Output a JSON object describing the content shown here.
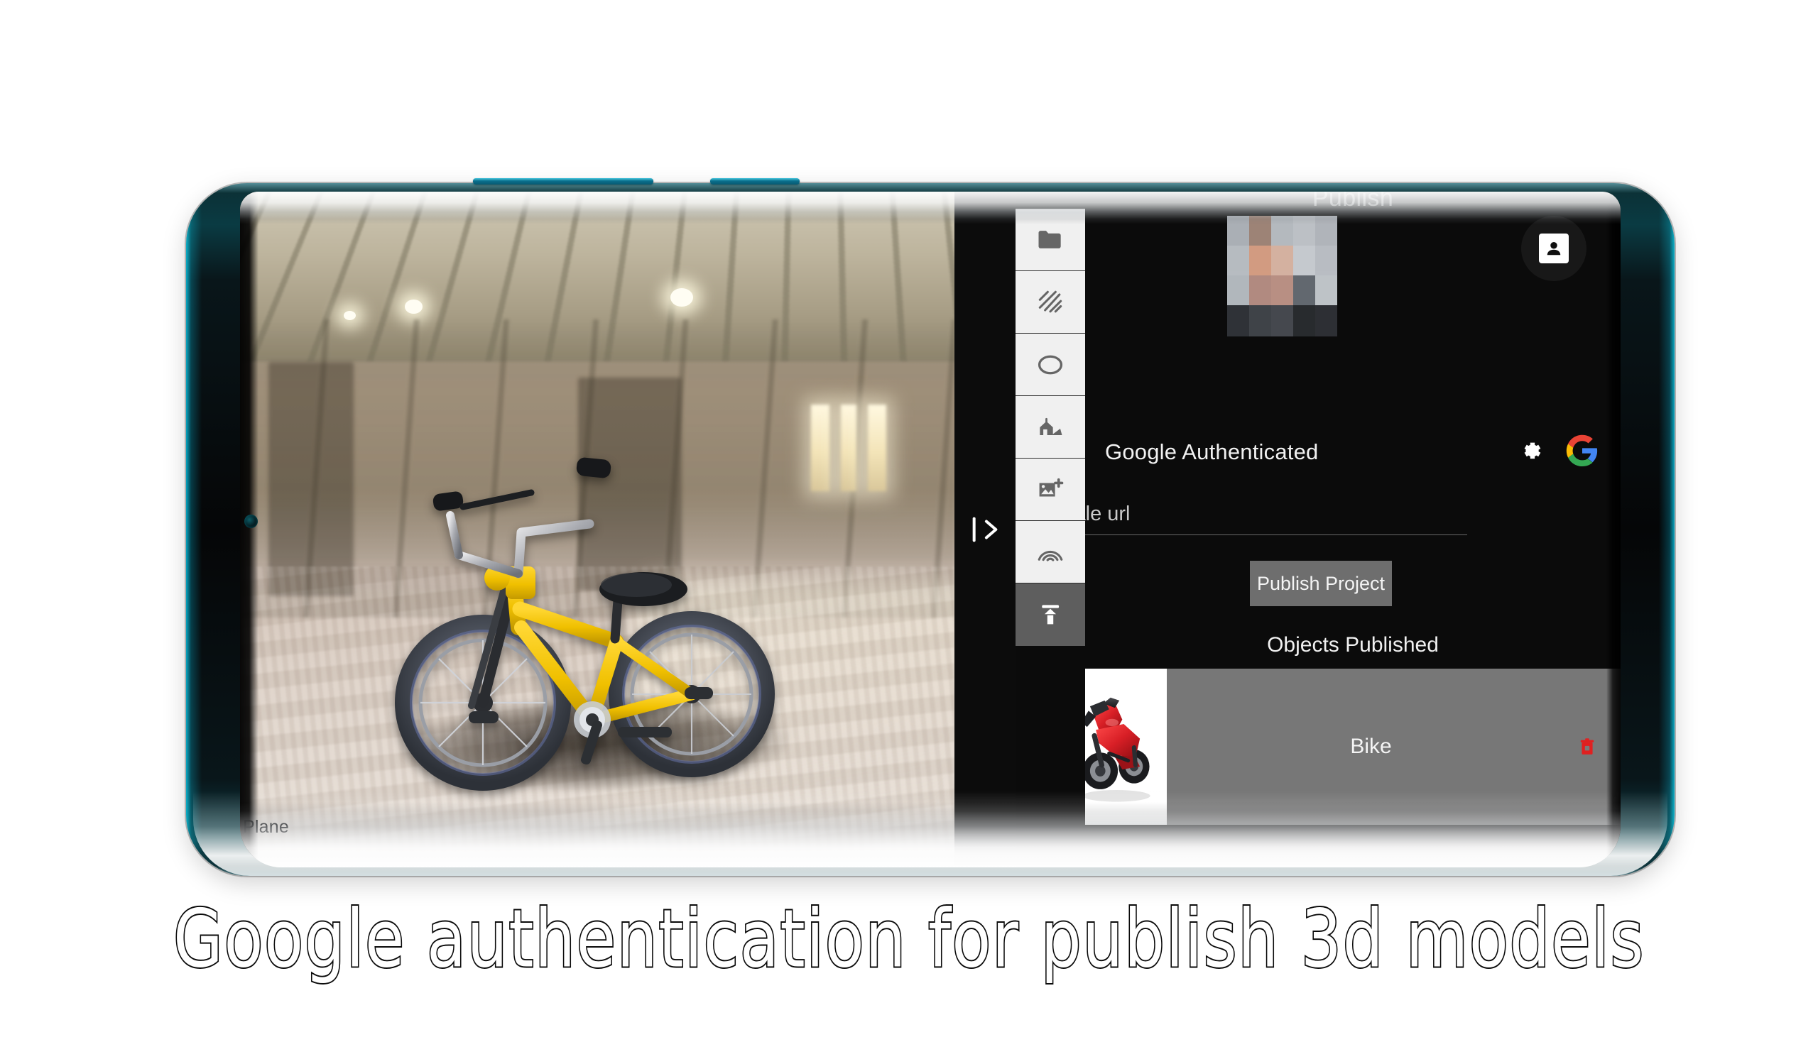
{
  "caption": "Google authentication for publish 3d models",
  "viewport": {
    "object_label": "Plane",
    "scene_description": "yellow BMX bicycle in abandoned warehouse HDRI"
  },
  "panel_toggle": {
    "icon": "arrow-right-to-bar-icon",
    "label": "Collapse panel"
  },
  "toolbar": {
    "items": [
      {
        "icon": "folder-icon",
        "name": "open-project",
        "active": false
      },
      {
        "icon": "texture-icon",
        "name": "material",
        "active": false
      },
      {
        "icon": "ellipse-icon",
        "name": "shape",
        "active": false
      },
      {
        "icon": "scene-house-icon",
        "name": "environment",
        "active": false
      },
      {
        "icon": "add-image-icon",
        "name": "add-image",
        "active": false
      },
      {
        "icon": "arc-icon",
        "name": "arc-tool",
        "active": false
      },
      {
        "icon": "upload-icon",
        "name": "publish",
        "active": true
      }
    ]
  },
  "publish_panel": {
    "title": "Publish",
    "avatar_alt": "censored profile photo",
    "account_icon": "account-box-icon",
    "auth_status": "Google Authenticated",
    "settings_icon": "gear-icon",
    "google_icon": "google-g-icon",
    "sale_url": {
      "placeholder": "sale url",
      "value": ""
    },
    "publish_button": "Publish Project",
    "objects_header": "Objects Published",
    "objects": [
      {
        "name": "Bike",
        "thumbnail": "red-motorcycle-thumbnail",
        "delete_icon": "trash-icon"
      }
    ]
  },
  "colors": {
    "phone_edge": "#0a9ab8",
    "panel_bg": "#0b0b0b",
    "row_bg": "#777777",
    "button_bg": "#6e6e6e",
    "toolbar_bg": "#f0f0f0",
    "toolbar_active_bg": "#5e5e5e",
    "delete_red": "#e02020",
    "google_red": "#ea4335",
    "google_yellow": "#fbbc05",
    "google_green": "#34a853",
    "google_blue": "#4285f4",
    "bike_yellow": "#f2c400"
  }
}
